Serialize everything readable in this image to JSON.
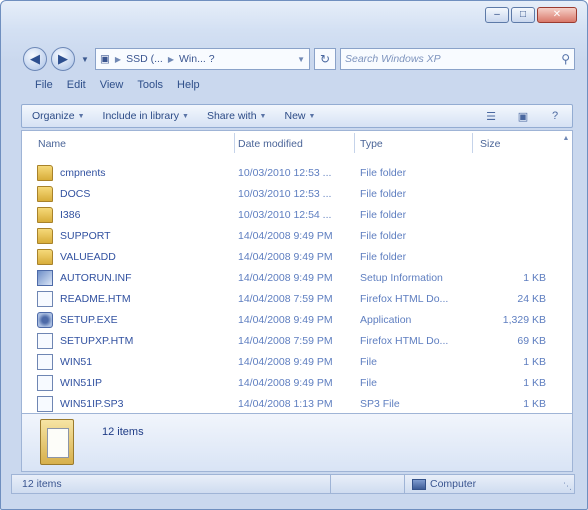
{
  "window": {
    "caption_buttons": [
      "–",
      "□",
      "✕"
    ]
  },
  "address": {
    "drive": "SSD (...",
    "folder": "Win... ?",
    "search_placeholder": "Search Windows XP"
  },
  "menu": [
    "File",
    "Edit",
    "View",
    "Tools",
    "Help"
  ],
  "toolbar": {
    "organize": "Organize",
    "include": "Include in library",
    "share": "Share with",
    "new": "New"
  },
  "columns": [
    "Name",
    "Date modified",
    "Type",
    "Size"
  ],
  "files": [
    {
      "name": "cmpnents",
      "date": "10/03/2010 12:53 ...",
      "type": "File folder",
      "size": "",
      "icon": "folder-icon"
    },
    {
      "name": "DOCS",
      "date": "10/03/2010 12:53 ...",
      "type": "File folder",
      "size": "",
      "icon": "folder-icon"
    },
    {
      "name": "I386",
      "date": "10/03/2010 12:54 ...",
      "type": "File folder",
      "size": "",
      "icon": "folder-icon"
    },
    {
      "name": "SUPPORT",
      "date": "14/04/2008 9:49 PM",
      "type": "File folder",
      "size": "",
      "icon": "folder-icon"
    },
    {
      "name": "VALUEADD",
      "date": "14/04/2008 9:49 PM",
      "type": "File folder",
      "size": "",
      "icon": "folder-icon"
    },
    {
      "name": "AUTORUN.INF",
      "date": "14/04/2008 9:49 PM",
      "type": "Setup Information",
      "size": "1 KB",
      "icon": "setup-icon"
    },
    {
      "name": "README.HTM",
      "date": "14/04/2008 7:59 PM",
      "type": "Firefox HTML Do...",
      "size": "24 KB",
      "icon": "file-icon"
    },
    {
      "name": "SETUP.EXE",
      "date": "14/04/2008 9:49 PM",
      "type": "Application",
      "size": "1,329 KB",
      "icon": "app-icon"
    },
    {
      "name": "SETUPXP.HTM",
      "date": "14/04/2008 7:59 PM",
      "type": "Firefox HTML Do...",
      "size": "69 KB",
      "icon": "file-icon"
    },
    {
      "name": "WIN51",
      "date": "14/04/2008 9:49 PM",
      "type": "File",
      "size": "1 KB",
      "icon": "file-icon"
    },
    {
      "name": "WIN51IP",
      "date": "14/04/2008 9:49 PM",
      "type": "File",
      "size": "1 KB",
      "icon": "file-icon"
    },
    {
      "name": "WIN51IP.SP3",
      "date": "14/04/2008 1:13 PM",
      "type": "SP3 File",
      "size": "1 KB",
      "icon": "file-icon"
    }
  ],
  "details": {
    "count": "12 items"
  },
  "status": {
    "left": "12 items",
    "right": "Computer"
  }
}
